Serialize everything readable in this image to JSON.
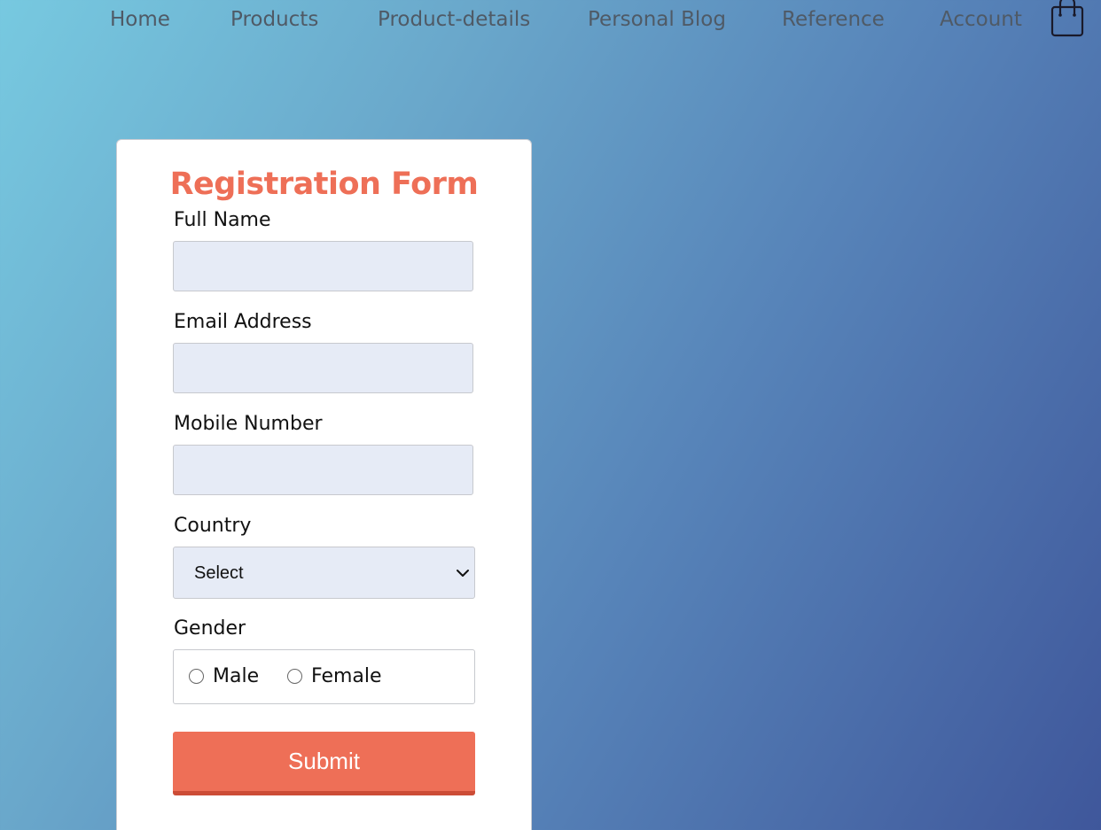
{
  "nav": {
    "links": [
      "Home",
      "Products",
      "Product-details",
      "Personal Blog",
      "Reference",
      "Account"
    ],
    "cart_icon": "shopping-bag-icon"
  },
  "form": {
    "title": "Registration Form",
    "full_name": {
      "label": "Full Name",
      "value": ""
    },
    "email": {
      "label": "Email Address",
      "value": ""
    },
    "mobile": {
      "label": "Mobile Number",
      "value": ""
    },
    "country": {
      "label": "Country",
      "selected": "Select"
    },
    "gender": {
      "label": "Gender",
      "options": [
        "Male",
        "Female"
      ]
    },
    "submit_label": "Submit"
  },
  "colors": {
    "accent": "#ee6f57",
    "input_bg": "#e6ebf6",
    "nav_text": "#4f5a66"
  }
}
